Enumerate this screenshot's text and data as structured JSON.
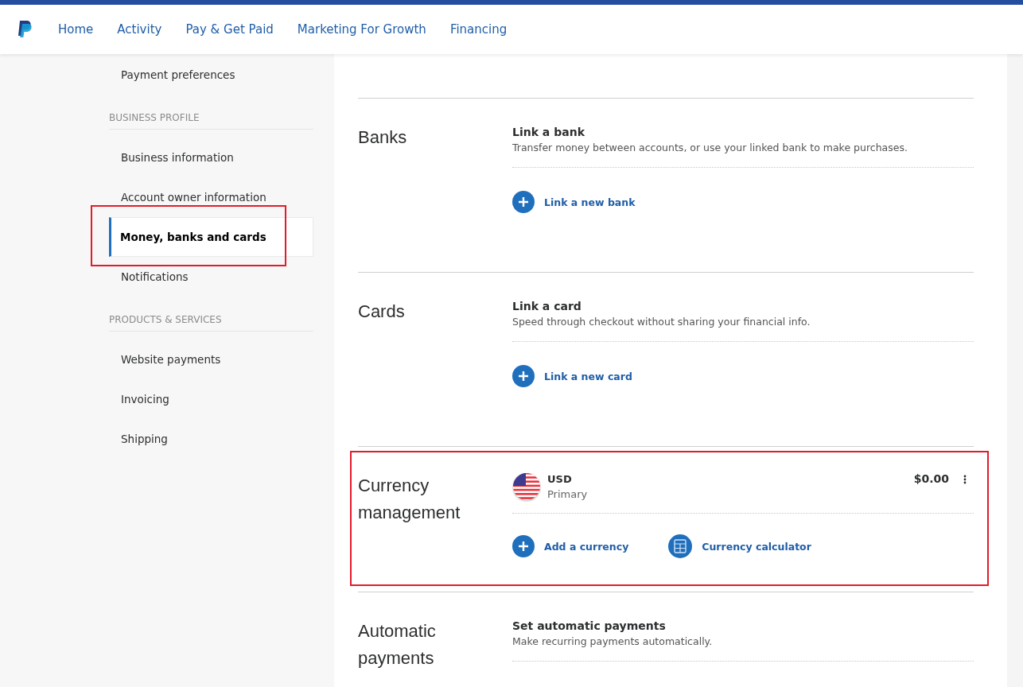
{
  "nav": {
    "items": [
      {
        "label": "Home",
        "selected": false
      },
      {
        "label": "Activity",
        "selected": false
      },
      {
        "label": "Pay & Get Paid",
        "selected": false
      },
      {
        "label": "Marketing For Growth",
        "selected": false
      },
      {
        "label": "Financing",
        "selected": false
      }
    ]
  },
  "sidebar": {
    "items": [
      {
        "kind": "item",
        "label": "Payment preferences",
        "selected": false,
        "highlighted": false
      },
      {
        "kind": "header",
        "label": "BUSINESS PROFILE"
      },
      {
        "kind": "item",
        "label": "Business information",
        "selected": false,
        "highlighted": false
      },
      {
        "kind": "item",
        "label": "Account owner information",
        "selected": false,
        "highlighted": false
      },
      {
        "kind": "item",
        "label": "Money, banks and cards",
        "selected": true,
        "highlighted": true
      },
      {
        "kind": "item",
        "label": "Notifications",
        "selected": false,
        "highlighted": false
      },
      {
        "kind": "header",
        "label": "PRODUCTS & SERVICES"
      },
      {
        "kind": "item",
        "label": "Website payments",
        "selected": false,
        "highlighted": false
      },
      {
        "kind": "item",
        "label": "Invoicing",
        "selected": false,
        "highlighted": false
      },
      {
        "kind": "item",
        "label": "Shipping",
        "selected": false,
        "highlighted": false
      }
    ]
  },
  "sections": [
    {
      "kind": "link",
      "title": "Banks",
      "heading": "Link a bank",
      "description": "Transfer money between accounts, or use your linked bank to make purchases.",
      "link": "Link a new bank",
      "highlighted": false
    },
    {
      "kind": "link",
      "title": "Cards",
      "heading": "Link a card",
      "description": "Speed through checkout without sharing your financial info.",
      "link": "Link a new card",
      "highlighted": false
    },
    {
      "kind": "currency",
      "title": "Currency management",
      "currency": {
        "code": "USD",
        "label": "Primary",
        "balance": "$0.00"
      },
      "actions": [
        {
          "kind": "add",
          "label": "Add a currency"
        },
        {
          "kind": "calculator",
          "label": "Currency calculator"
        }
      ],
      "highlighted": true
    },
    {
      "kind": "link",
      "title": "Automatic payments",
      "heading": "Set automatic payments",
      "description": "Make recurring payments automatically."
    }
  ]
}
